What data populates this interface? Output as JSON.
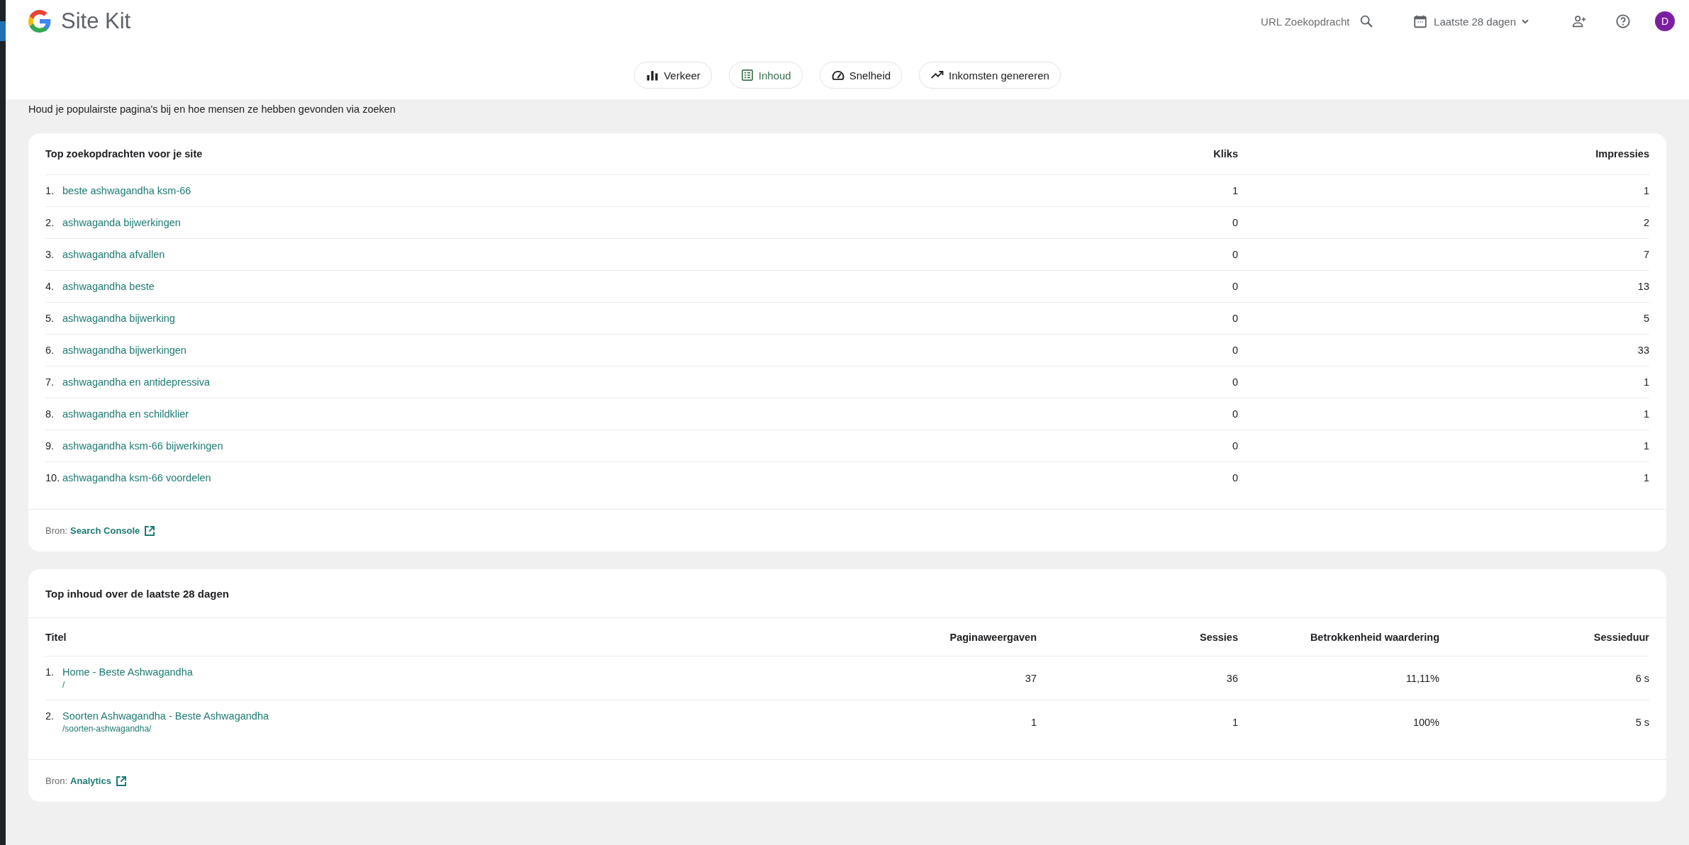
{
  "header": {
    "logo_text": "Site Kit",
    "search": {
      "placeholder": "URL Zoekopdracht"
    },
    "date_range": "Laatste 28 dagen",
    "avatar_initial": "D"
  },
  "tabs": [
    {
      "label": "Verkeer",
      "kind": "bars",
      "selected": false
    },
    {
      "label": "Inhoud",
      "kind": "list",
      "selected": true
    },
    {
      "label": "Snelheid",
      "kind": "gauge",
      "selected": false
    },
    {
      "label": "Inkomsten genereren",
      "kind": "trend",
      "selected": false
    }
  ],
  "section": {
    "subtitle": "Houd je populairste pagina's bij en hoe mensen ze hebben gevonden via zoeken"
  },
  "search_card": {
    "columns": [
      "Top zoekopdrachten voor je site",
      "Kliks",
      "Impressies"
    ],
    "rows": [
      {
        "rank": "1.",
        "query": "beste ashwagandha ksm-66",
        "clicks": "1",
        "impressions": "1"
      },
      {
        "rank": "2.",
        "query": "ashwaganda bijwerkingen",
        "clicks": "0",
        "impressions": "2"
      },
      {
        "rank": "3.",
        "query": "ashwagandha afvallen",
        "clicks": "0",
        "impressions": "7"
      },
      {
        "rank": "4.",
        "query": "ashwagandha beste",
        "clicks": "0",
        "impressions": "13"
      },
      {
        "rank": "5.",
        "query": "ashwagandha bijwerking",
        "clicks": "0",
        "impressions": "5"
      },
      {
        "rank": "6.",
        "query": "ashwagandha bijwerkingen",
        "clicks": "0",
        "impressions": "33"
      },
      {
        "rank": "7.",
        "query": "ashwagandha en antidepressiva",
        "clicks": "0",
        "impressions": "1"
      },
      {
        "rank": "8.",
        "query": "ashwagandha en schildklier",
        "clicks": "0",
        "impressions": "1"
      },
      {
        "rank": "9.",
        "query": "ashwagandha ksm-66 bijwerkingen",
        "clicks": "0",
        "impressions": "1"
      },
      {
        "rank": "10.",
        "query": "ashwagandha ksm-66 voordelen",
        "clicks": "0",
        "impressions": "1"
      }
    ],
    "source_label": "Bron:",
    "source_link": "Search Console"
  },
  "content_card": {
    "title": "Top inhoud over de laatste 28 dagen",
    "columns": [
      "Titel",
      "Paginaweergaven",
      "Sessies",
      "Betrokkenheid waardering",
      "Sessieduur"
    ],
    "rows": [
      {
        "rank": "1.",
        "title": "Home - Beste Ashwagandha",
        "path": "/",
        "pageviews": "37",
        "sessions": "36",
        "engagement": "11,11%",
        "duration": "6 s"
      },
      {
        "rank": "2.",
        "title": "Soorten Ashwagandha - Beste Ashwagandha",
        "path": "/soorten-ashwagandha/",
        "pageviews": "1",
        "sessions": "1",
        "engagement": "100%",
        "duration": "5 s"
      }
    ],
    "source_label": "Bron:",
    "source_link": "Analytics"
  }
}
